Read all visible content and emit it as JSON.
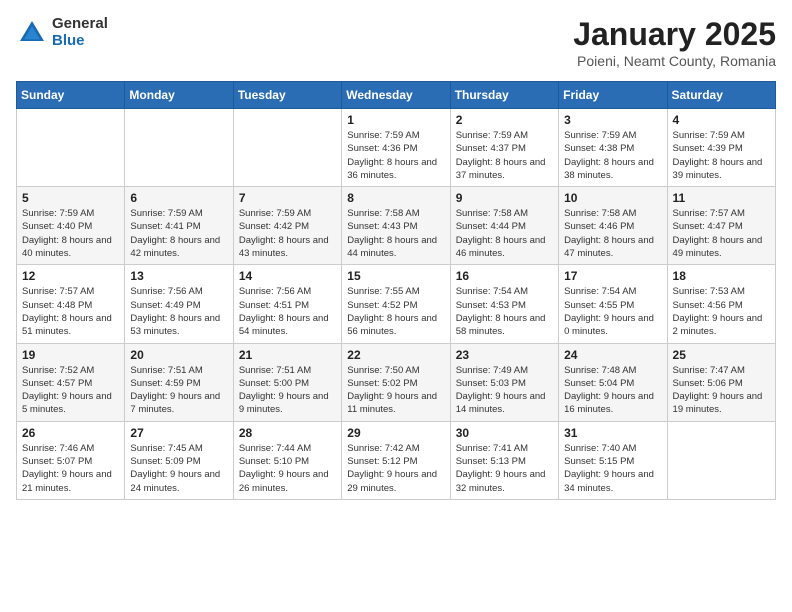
{
  "logo": {
    "general": "General",
    "blue": "Blue"
  },
  "title": "January 2025",
  "location": "Poieni, Neamt County, Romania",
  "days_of_week": [
    "Sunday",
    "Monday",
    "Tuesday",
    "Wednesday",
    "Thursday",
    "Friday",
    "Saturday"
  ],
  "weeks": [
    [
      {
        "day": "",
        "info": ""
      },
      {
        "day": "",
        "info": ""
      },
      {
        "day": "",
        "info": ""
      },
      {
        "day": "1",
        "info": "Sunrise: 7:59 AM\nSunset: 4:36 PM\nDaylight: 8 hours and 36 minutes."
      },
      {
        "day": "2",
        "info": "Sunrise: 7:59 AM\nSunset: 4:37 PM\nDaylight: 8 hours and 37 minutes."
      },
      {
        "day": "3",
        "info": "Sunrise: 7:59 AM\nSunset: 4:38 PM\nDaylight: 8 hours and 38 minutes."
      },
      {
        "day": "4",
        "info": "Sunrise: 7:59 AM\nSunset: 4:39 PM\nDaylight: 8 hours and 39 minutes."
      }
    ],
    [
      {
        "day": "5",
        "info": "Sunrise: 7:59 AM\nSunset: 4:40 PM\nDaylight: 8 hours and 40 minutes."
      },
      {
        "day": "6",
        "info": "Sunrise: 7:59 AM\nSunset: 4:41 PM\nDaylight: 8 hours and 42 minutes."
      },
      {
        "day": "7",
        "info": "Sunrise: 7:59 AM\nSunset: 4:42 PM\nDaylight: 8 hours and 43 minutes."
      },
      {
        "day": "8",
        "info": "Sunrise: 7:58 AM\nSunset: 4:43 PM\nDaylight: 8 hours and 44 minutes."
      },
      {
        "day": "9",
        "info": "Sunrise: 7:58 AM\nSunset: 4:44 PM\nDaylight: 8 hours and 46 minutes."
      },
      {
        "day": "10",
        "info": "Sunrise: 7:58 AM\nSunset: 4:46 PM\nDaylight: 8 hours and 47 minutes."
      },
      {
        "day": "11",
        "info": "Sunrise: 7:57 AM\nSunset: 4:47 PM\nDaylight: 8 hours and 49 minutes."
      }
    ],
    [
      {
        "day": "12",
        "info": "Sunrise: 7:57 AM\nSunset: 4:48 PM\nDaylight: 8 hours and 51 minutes."
      },
      {
        "day": "13",
        "info": "Sunrise: 7:56 AM\nSunset: 4:49 PM\nDaylight: 8 hours and 53 minutes."
      },
      {
        "day": "14",
        "info": "Sunrise: 7:56 AM\nSunset: 4:51 PM\nDaylight: 8 hours and 54 minutes."
      },
      {
        "day": "15",
        "info": "Sunrise: 7:55 AM\nSunset: 4:52 PM\nDaylight: 8 hours and 56 minutes."
      },
      {
        "day": "16",
        "info": "Sunrise: 7:54 AM\nSunset: 4:53 PM\nDaylight: 8 hours and 58 minutes."
      },
      {
        "day": "17",
        "info": "Sunrise: 7:54 AM\nSunset: 4:55 PM\nDaylight: 9 hours and 0 minutes."
      },
      {
        "day": "18",
        "info": "Sunrise: 7:53 AM\nSunset: 4:56 PM\nDaylight: 9 hours and 2 minutes."
      }
    ],
    [
      {
        "day": "19",
        "info": "Sunrise: 7:52 AM\nSunset: 4:57 PM\nDaylight: 9 hours and 5 minutes."
      },
      {
        "day": "20",
        "info": "Sunrise: 7:51 AM\nSunset: 4:59 PM\nDaylight: 9 hours and 7 minutes."
      },
      {
        "day": "21",
        "info": "Sunrise: 7:51 AM\nSunset: 5:00 PM\nDaylight: 9 hours and 9 minutes."
      },
      {
        "day": "22",
        "info": "Sunrise: 7:50 AM\nSunset: 5:02 PM\nDaylight: 9 hours and 11 minutes."
      },
      {
        "day": "23",
        "info": "Sunrise: 7:49 AM\nSunset: 5:03 PM\nDaylight: 9 hours and 14 minutes."
      },
      {
        "day": "24",
        "info": "Sunrise: 7:48 AM\nSunset: 5:04 PM\nDaylight: 9 hours and 16 minutes."
      },
      {
        "day": "25",
        "info": "Sunrise: 7:47 AM\nSunset: 5:06 PM\nDaylight: 9 hours and 19 minutes."
      }
    ],
    [
      {
        "day": "26",
        "info": "Sunrise: 7:46 AM\nSunset: 5:07 PM\nDaylight: 9 hours and 21 minutes."
      },
      {
        "day": "27",
        "info": "Sunrise: 7:45 AM\nSunset: 5:09 PM\nDaylight: 9 hours and 24 minutes."
      },
      {
        "day": "28",
        "info": "Sunrise: 7:44 AM\nSunset: 5:10 PM\nDaylight: 9 hours and 26 minutes."
      },
      {
        "day": "29",
        "info": "Sunrise: 7:42 AM\nSunset: 5:12 PM\nDaylight: 9 hours and 29 minutes."
      },
      {
        "day": "30",
        "info": "Sunrise: 7:41 AM\nSunset: 5:13 PM\nDaylight: 9 hours and 32 minutes."
      },
      {
        "day": "31",
        "info": "Sunrise: 7:40 AM\nSunset: 5:15 PM\nDaylight: 9 hours and 34 minutes."
      },
      {
        "day": "",
        "info": ""
      }
    ]
  ]
}
